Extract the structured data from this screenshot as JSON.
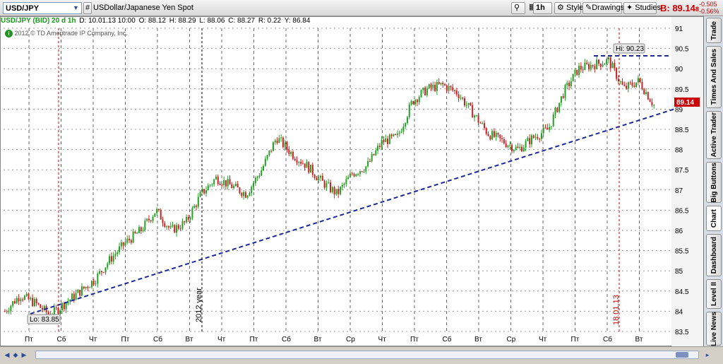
{
  "toolbar": {
    "symbol": "USD/JPY",
    "hash_label": "#",
    "description": "USDollar/Japanese Yen Spot",
    "timeframe": "1h",
    "style_label": "Style",
    "drawings_label": "Drawings",
    "studies_label": "Studies",
    "bid_price": "B: 89.14",
    "bid_price_sub": "8",
    "change_abs": "-0.505",
    "change_pct": "-0.56%"
  },
  "info_bar": {
    "symbol_period": "USD/JPY (BID) 20 d 1h",
    "date": "D: 10.01.13 10:00",
    "open": "O: 88.12",
    "high": "H: 88.29",
    "low": "L: 88.06",
    "close": "C: 88.27",
    "range": "R: 0.22",
    "y": "Y: 86.84",
    "copyright": "2012 © TD Ameritrade IP Company, Inc."
  },
  "side_tabs": [
    "Trade",
    "Times And Sales",
    "Active Trader",
    "Big Buttons",
    "Chart",
    "Dashboard",
    "Level II",
    "Live News"
  ],
  "chart_data": {
    "type": "candlestick",
    "ylim": [
      83.5,
      91
    ],
    "y_ticks": [
      83.5,
      84,
      84.5,
      85,
      85.5,
      86,
      86.5,
      87,
      87.5,
      88,
      88.5,
      89,
      89.5,
      90,
      90.5,
      91
    ],
    "x_ticks": [
      "Пт",
      "Сб",
      "Чт",
      "Пт",
      "Сб",
      "Вт",
      "Чт",
      "Пт",
      "Сб",
      "Вт",
      "Ср",
      "Чт",
      "Пт",
      "Сб",
      "Вт",
      "Ср",
      "Чт",
      "Пт",
      "Сб",
      "Вт"
    ],
    "high_label": "Hi: 90.23",
    "low_label": "Lo: 83.85",
    "current_price_label": "89.14",
    "annotation_year": "2012 year",
    "annotation_date": "18.01.13",
    "path": [
      84.0,
      84.4,
      84.2,
      83.9,
      84.2,
      84.5,
      84.8,
      85.3,
      85.7,
      86.0,
      86.5,
      86.0,
      86.2,
      86.9,
      87.3,
      87.1,
      86.9,
      87.5,
      88.3,
      87.9,
      87.6,
      87.2,
      86.9,
      87.4,
      87.6,
      88.2,
      88.3,
      89.2,
      89.5,
      89.6,
      89.4,
      88.9,
      88.4,
      88.2,
      88.0,
      88.3,
      88.5,
      89.4,
      90.0,
      90.1,
      90.2,
      89.5,
      89.7,
      89.1
    ],
    "trendline_label": "",
    "colors": {
      "up": "#22a022",
      "down": "#cc1f1f",
      "trendline": "#1a2a9c",
      "grid": "#555555"
    }
  }
}
